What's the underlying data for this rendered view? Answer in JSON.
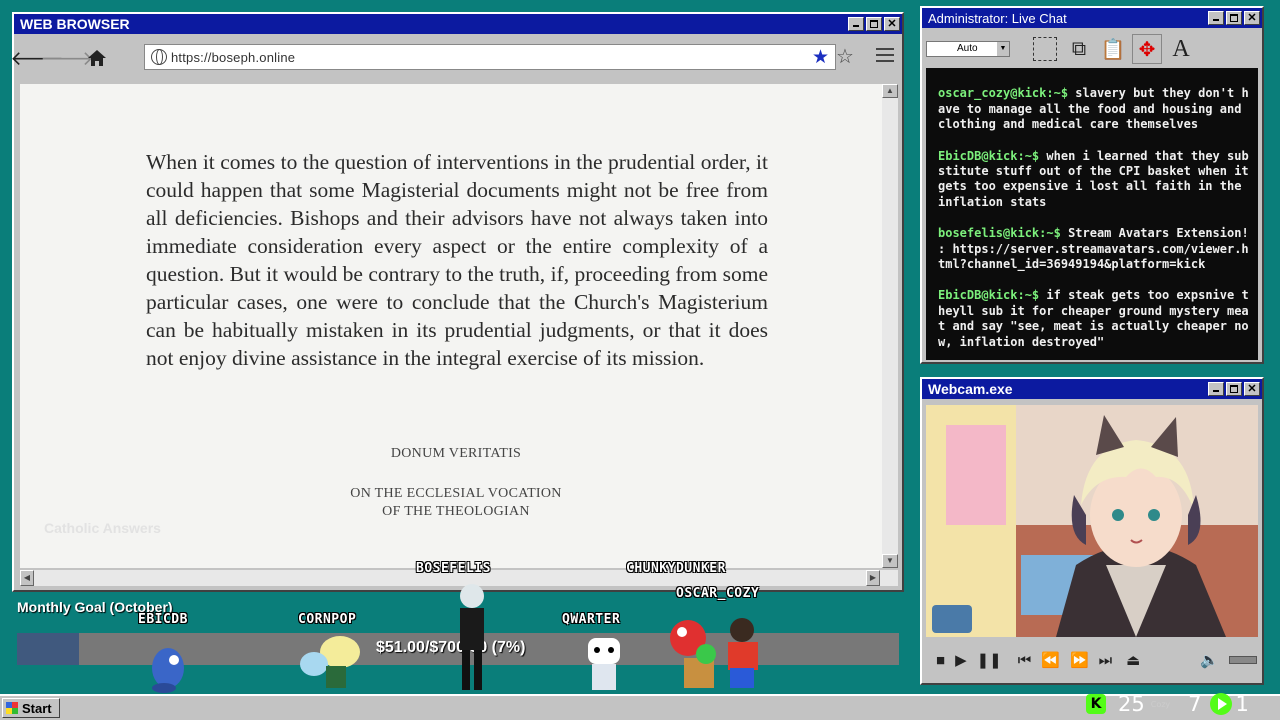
{
  "browser": {
    "title": "WEB BROWSER",
    "url": "https://boseph.online",
    "quote": "When it comes to the question of interventions in the prudential order, it could happen that some Magisterial documents might not be free from all deficiencies. Bishops and their advisors have not always taken into immediate consideration every aspect or the entire complexity of a question. But it would be contrary to the truth, if, proceeding from some particular cases, one were to conclude that the Church's Magisterium can be habitually mistaken in its prudential judgments, or that it does not enjoy divine assistance in the integral exercise of its mission.",
    "citation_title": "DONUM VERITATIS",
    "citation_sub1": "ON THE ECCLESIAL VOCATION",
    "citation_sub2": "OF THE THEOLOGIAN",
    "watermark": "Catholic Answers"
  },
  "chat": {
    "title": "Administrator: Live Chat",
    "font_select": "Auto",
    "messages": [
      {
        "user": "oscar_cozy@kick:~$",
        "text": "slavery but they don't have to manage all the food and housing and clothing and medical care themselves"
      },
      {
        "user": "EbicDB@kick:~$",
        "text": "when i learned that they substitute stuff out of the CPI basket when it gets too expensive i lost all faith in the inflation stats"
      },
      {
        "user": "bosefelis@kick:~$",
        "text": "Stream Avatars Extension! : https://server.streamavatars.com/viewer.html?channel_id=36949194&platform=kick"
      },
      {
        "user": "EbicDB@kick:~$",
        "text": "if steak gets too expsnive theyll sub it for cheaper ground mystery meat and say \"see, meat is actually cheaper now, inflation destroyed\""
      }
    ]
  },
  "webcam": {
    "title": "Webcam.exe"
  },
  "goal": {
    "title": "Monthly Goal (October)",
    "text": "$51.00/$700.00 (7%)",
    "progress": 0.07
  },
  "avatars": {
    "ebicdb": "EBICDB",
    "cornpop": "CORNPOP",
    "bosefelis": "BOSEFELIS",
    "qwarter": "QWARTER",
    "chunkydunker": "CHUNKYDUNKER",
    "oscar_cozy": "OSCAR_COZY"
  },
  "taskbar": {
    "start": "Start",
    "followers": "25",
    "cozy": "Cozy",
    "count": "7",
    "live": "1"
  }
}
